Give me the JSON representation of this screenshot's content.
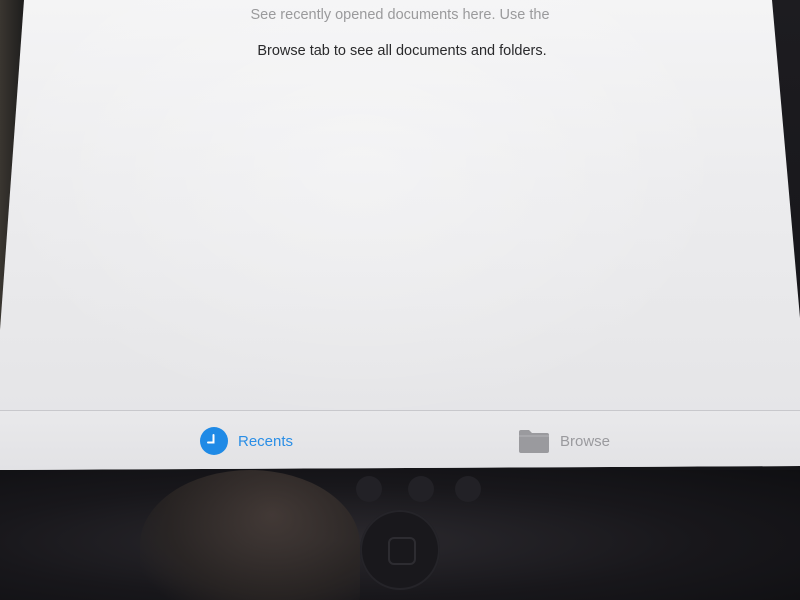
{
  "screen": {
    "message_line1_partial": "See recently opened documents here. Use the",
    "message_line2": "Browse tab to see all documents and folders."
  },
  "tabbar": {
    "tabs": [
      {
        "label": "Recents",
        "icon": "clock-icon",
        "selected": true
      },
      {
        "label": "Browse",
        "icon": "folder-icon",
        "selected": false
      }
    ]
  },
  "colors": {
    "accent": "#2a8ee6",
    "inactive": "#9a9a9e"
  }
}
